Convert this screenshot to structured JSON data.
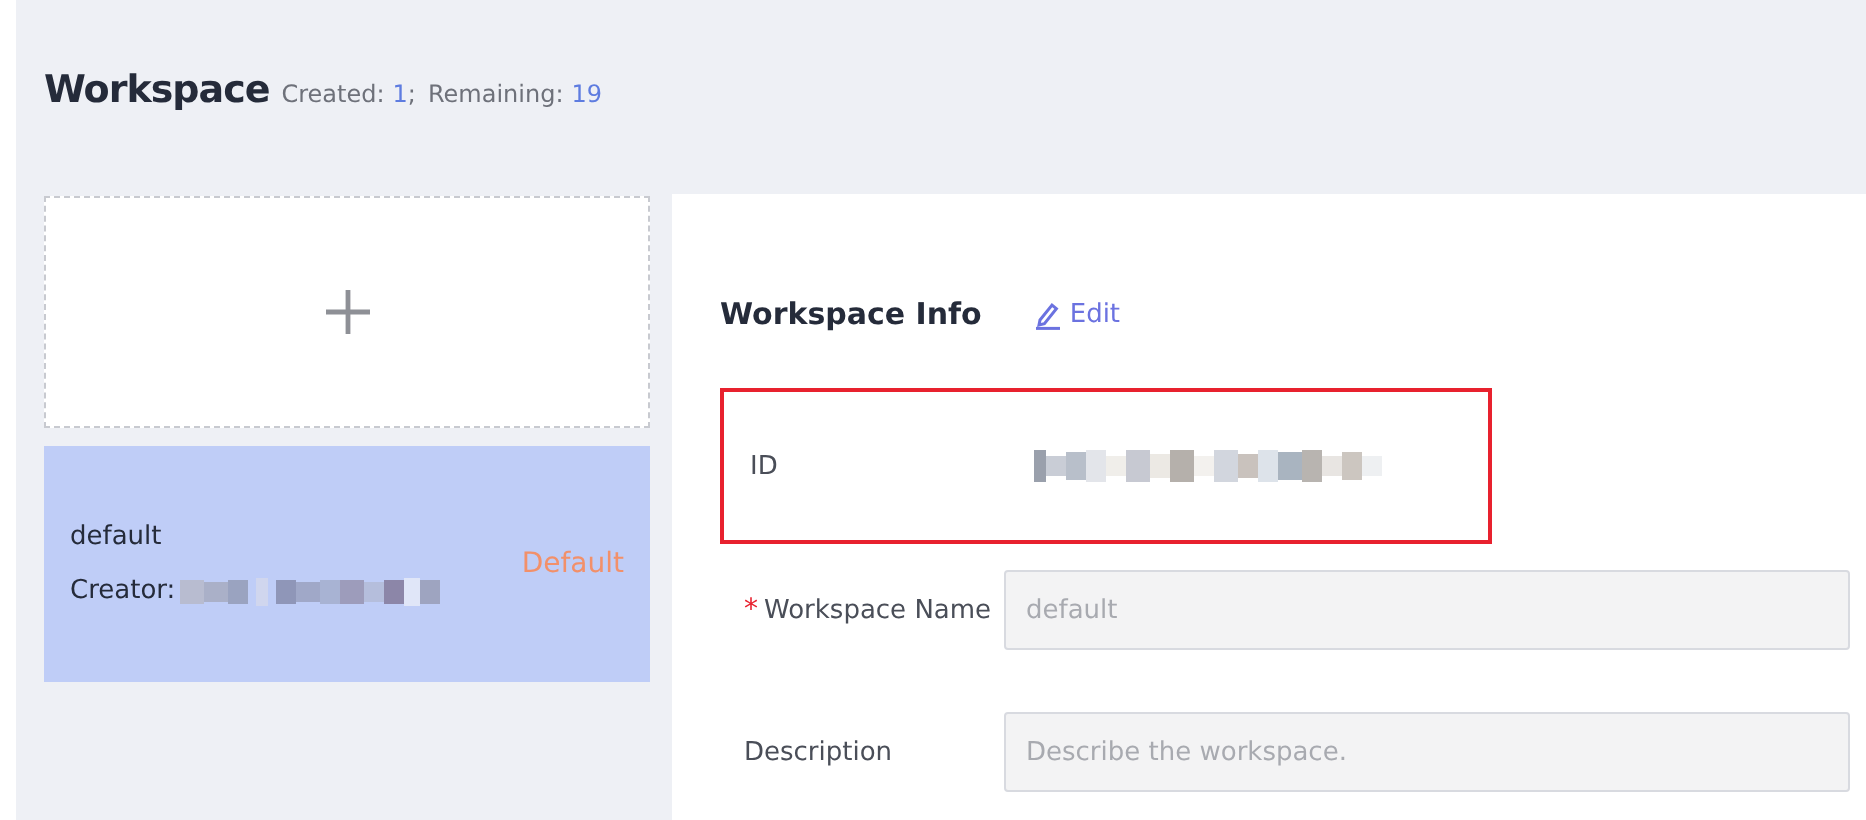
{
  "header": {
    "title": "Workspace",
    "separator": ";",
    "stats": [
      {
        "label": "Created:",
        "value": "1"
      },
      {
        "label": "Remaining:",
        "value": "19"
      }
    ]
  },
  "workspaces": [
    {
      "name": "default",
      "creator_label": "Creator:",
      "badge": "Default",
      "selected": true
    }
  ],
  "info": {
    "title": "Workspace Info",
    "edit": "Edit",
    "id_label": "ID",
    "highlighted": true,
    "required_mark": "*",
    "fields": [
      {
        "label": "Workspace Name",
        "required": true,
        "value": "default",
        "disabled": true
      },
      {
        "label": "Description",
        "required": false,
        "placeholder": "Describe the workspace.",
        "disabled": true
      }
    ]
  }
}
